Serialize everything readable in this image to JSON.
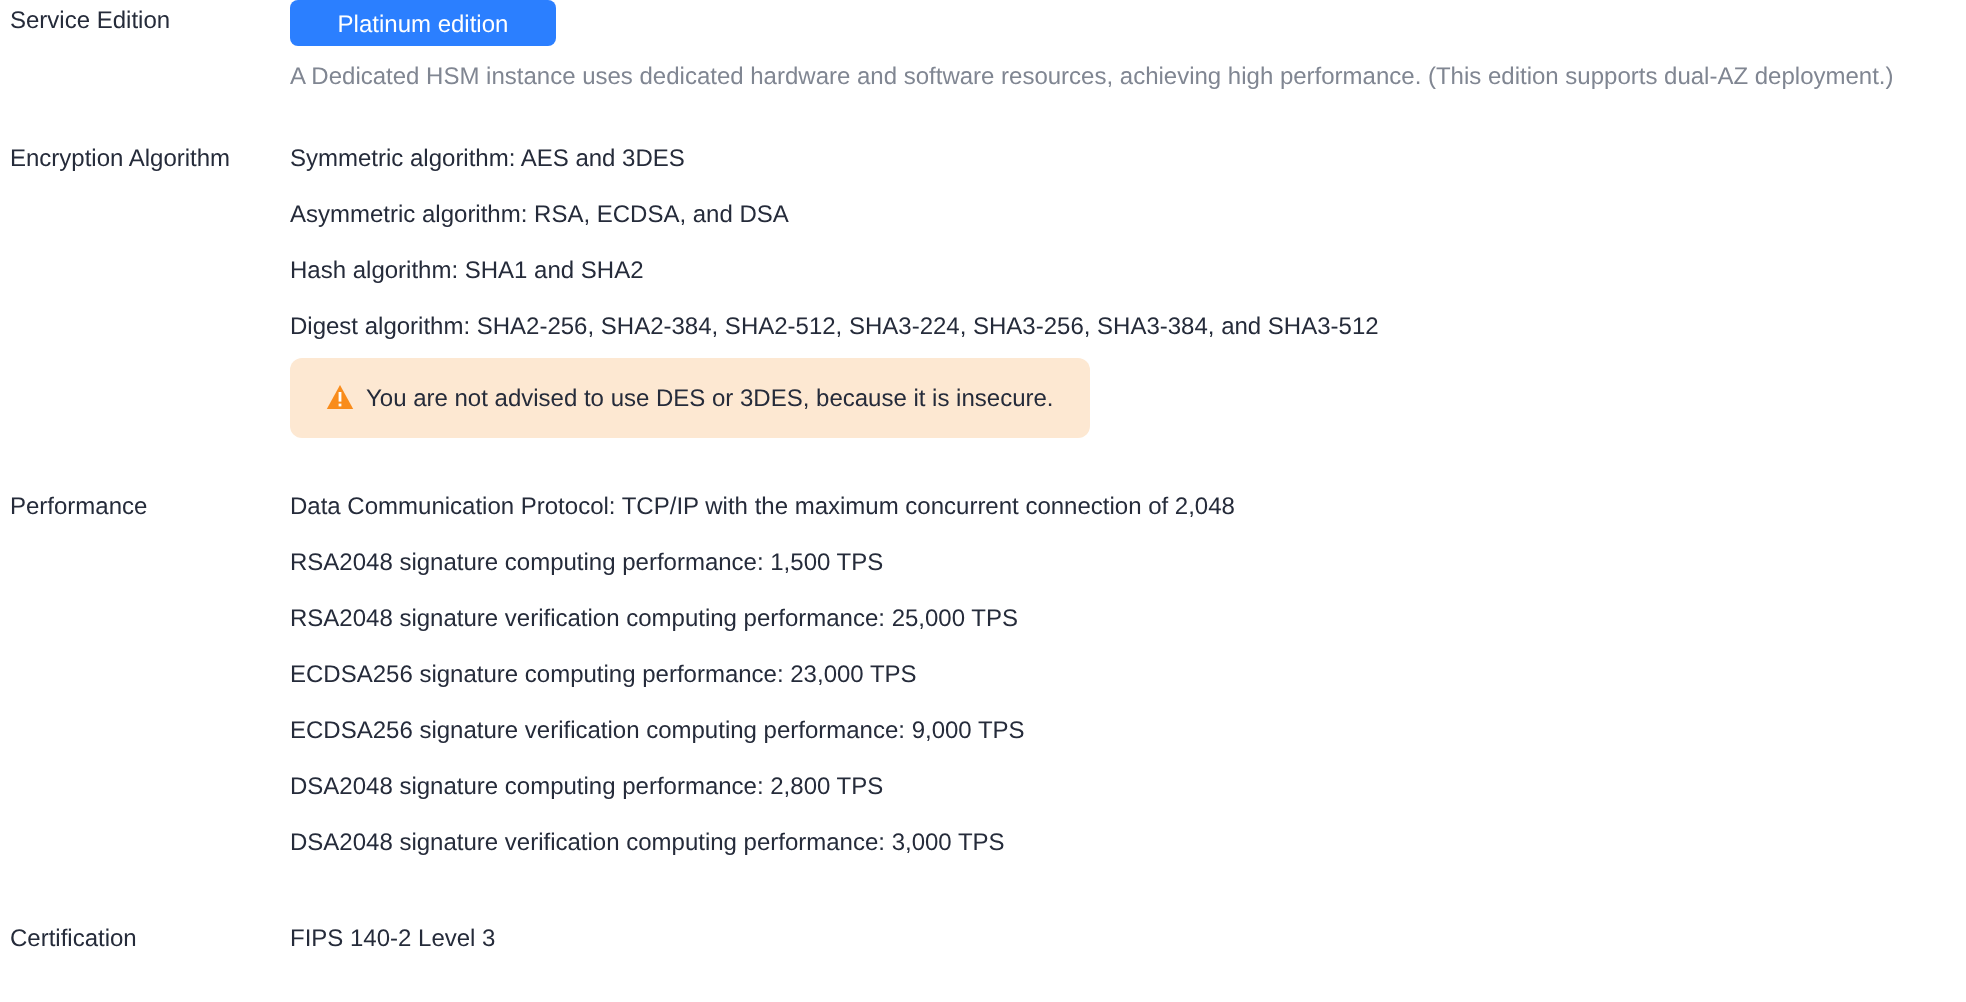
{
  "sections": [
    {
      "label": "Service Edition",
      "editions": [
        {
          "label": "Platinum edition",
          "selected": true
        }
      ],
      "description": "A Dedicated HSM instance uses dedicated hardware and software resources, achieving high performance. (This edition supports dual-AZ deployment.)"
    },
    {
      "label": "Encryption Algorithm",
      "lines": [
        "Symmetric algorithm: AES and 3DES",
        "Asymmetric algorithm: RSA, ECDSA, and DSA",
        "Hash algorithm: SHA1 and SHA2",
        "Digest algorithm: SHA2-256, SHA2-384, SHA2-512, SHA3-224, SHA3-256, SHA3-384, and SHA3-512"
      ],
      "warning": "You are not advised to use DES or 3DES, because it is insecure."
    },
    {
      "label": "Performance",
      "lines": [
        "Data Communication Protocol: TCP/IP with the maximum concurrent connection of 2,048",
        "RSA2048 signature computing performance: 1,500 TPS",
        "RSA2048 signature verification computing performance: 25,000 TPS",
        "ECDSA256 signature computing performance: 23,000 TPS",
        "ECDSA256 signature verification computing performance: 9,000 TPS",
        "DSA2048 signature computing performance: 2,800 TPS",
        "DSA2048 signature verification computing performance: 3,000 TPS"
      ]
    },
    {
      "label": "Certification",
      "lines": [
        "FIPS 140-2 Level 3"
      ]
    }
  ]
}
